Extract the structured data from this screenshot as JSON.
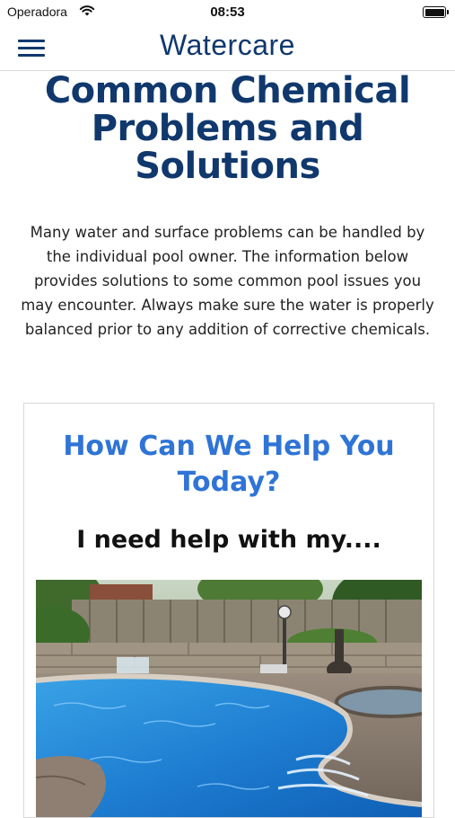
{
  "status_bar": {
    "carrier": "Operadora",
    "time": "08:53"
  },
  "header": {
    "brand": "Watercare"
  },
  "page": {
    "title": "Common Chemical Problems and Solutions",
    "intro": "Many water and surface problems can be handled by the individual pool owner. The information below provides solutions to some common pool issues you may encounter. Always make sure the water is properly balanced prior to any addition of corrective chemicals."
  },
  "card": {
    "heading": "How Can We Help You Today?",
    "subheading": "I need help with my....",
    "image_subject": "backyard swimming pool"
  },
  "colors": {
    "brand_navy": "#10386d",
    "accent_blue": "#2f74d6",
    "pool_water": "#2a8fd8"
  }
}
